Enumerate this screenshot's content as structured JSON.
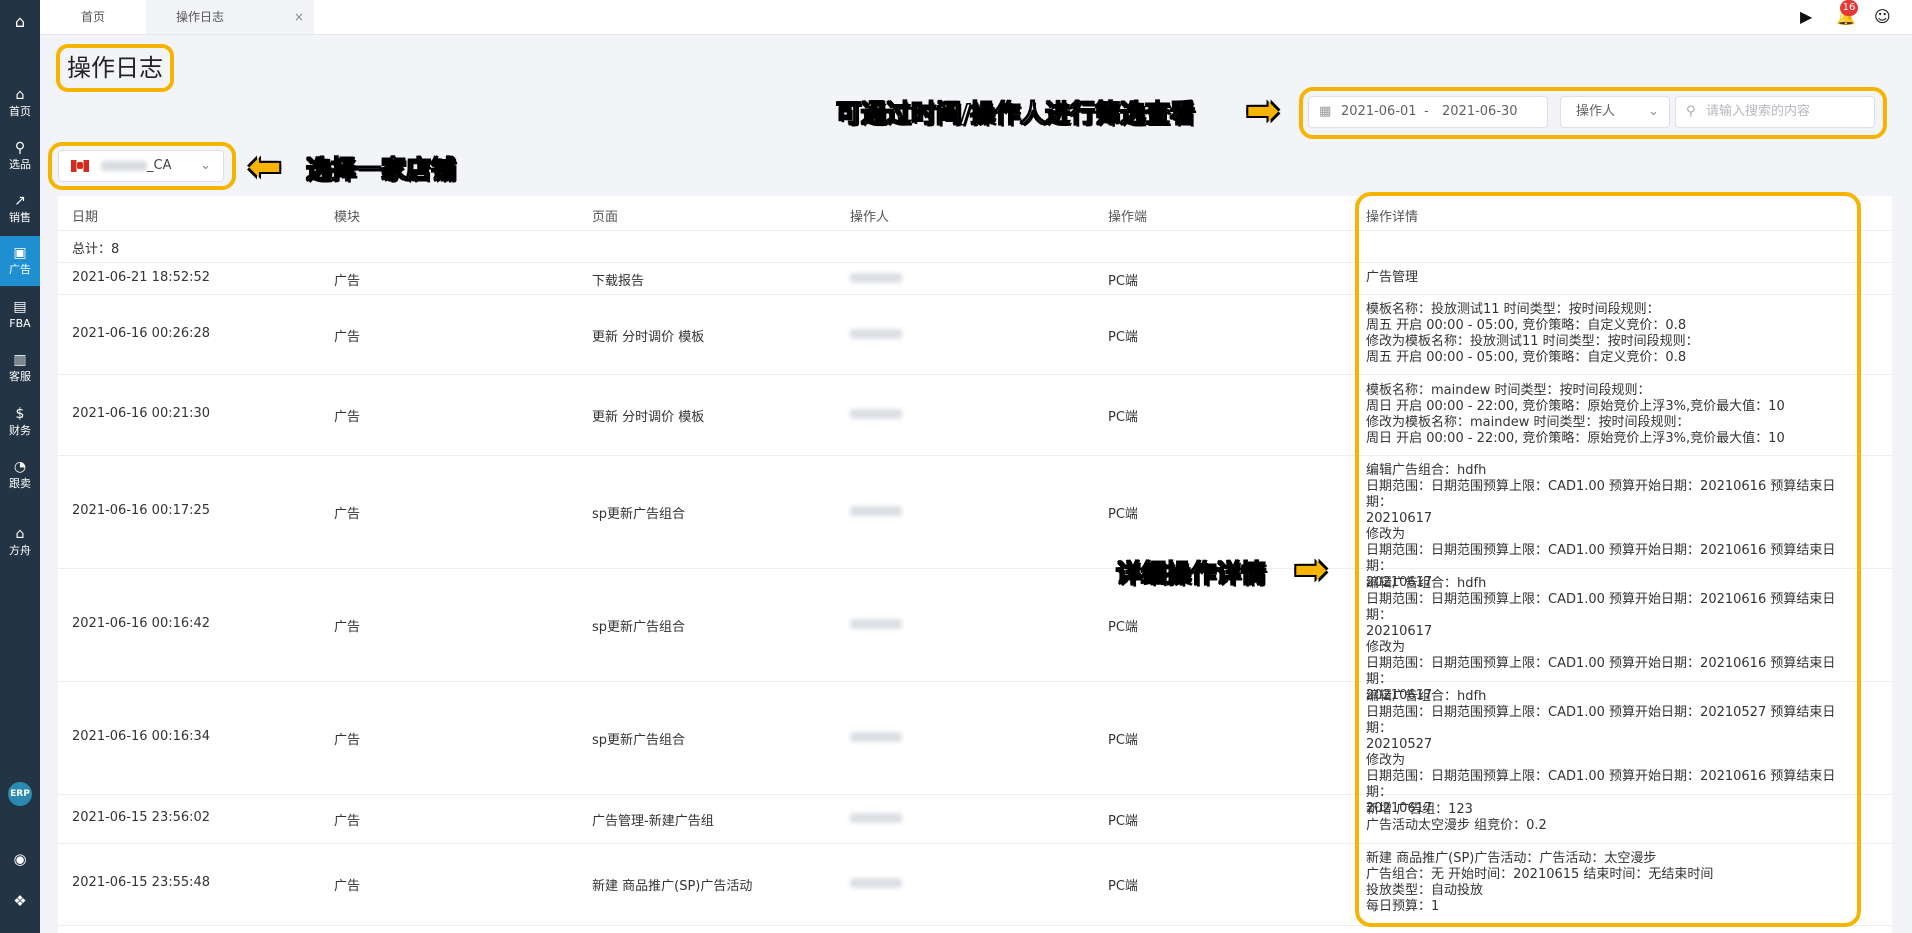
{
  "sidebar": {
    "items": [
      {
        "label": "首页",
        "icon": "home-icon"
      },
      {
        "label": "选品",
        "icon": "search-icon"
      },
      {
        "label": "销售",
        "icon": "chart-icon"
      },
      {
        "label": "广告",
        "icon": "ad-icon"
      },
      {
        "label": "FBA",
        "icon": "fba-icon"
      },
      {
        "label": "客服",
        "icon": "service-icon"
      },
      {
        "label": "财务",
        "icon": "finance-icon"
      },
      {
        "label": "跟卖",
        "icon": "pie-icon"
      },
      {
        "label": "方舟",
        "icon": "ark-icon"
      }
    ],
    "erp_label": "ERP"
  },
  "tabs": {
    "home": "首页",
    "log": "操作日志",
    "close": "×"
  },
  "header": {
    "notification_count": "16"
  },
  "page": {
    "title": "操作日志"
  },
  "filters": {
    "date_start": "2021-06-01",
    "date_sep": "-",
    "date_end": "2021-06-30",
    "operator": "操作人",
    "search_placeholder": "请输入搜索的内容"
  },
  "store": {
    "name_suffix": "_CA"
  },
  "annotations": {
    "filter": "可通过时间/操作人进行筛选查看",
    "store": "选择一家店铺",
    "details": "详细操作详情"
  },
  "table": {
    "headers": [
      "日期",
      "模块",
      "页面",
      "操作人",
      "操作端",
      "操作详情"
    ],
    "total": "总计：8",
    "rows": [
      {
        "date": "2021-06-21 18:52:52",
        "module": "广告",
        "page": "下载报告",
        "client": "PC端",
        "details": [
          "广告管理"
        ]
      },
      {
        "date": "2021-06-16 00:26:28",
        "module": "广告",
        "page": "更新 分时调价 模板",
        "client": "PC端",
        "details": [
          "模板名称：投放测试11 时间类型：按时间段规则：",
          "周五 开启 00:00 - 05:00, 竞价策略：自定义竞价：0.8",
          "修改为模板名称：投放测试11 时间类型：按时间段规则：",
          "周五 开启 00:00 - 05:00, 竞价策略：自定义竞价：0.8"
        ]
      },
      {
        "date": "2021-06-16 00:21:30",
        "module": "广告",
        "page": "更新 分时调价 模板",
        "client": "PC端",
        "details": [
          "模板名称：maindew 时间类型：按时间段规则：",
          "周日 开启 00:00 - 22:00, 竞价策略：原始竞价上浮3%,竞价最大值：10",
          "修改为模板名称：maindew 时间类型：按时间段规则：",
          "周日 开启 00:00 - 22:00, 竞价策略：原始竞价上浮3%,竞价最大值：10"
        ]
      },
      {
        "date": "2021-06-16 00:17:25",
        "module": "广告",
        "page": "sp更新广告组合",
        "client": "PC端",
        "details": [
          "编辑广告组合：hdfh",
          "日期范围：日期范围预算上限：CAD1.00 预算开始日期：20210616 预算结束日期：",
          "20210617",
          "修改为",
          "日期范围：日期范围预算上限：CAD1.00 预算开始日期：20210616 预算结束日期：",
          "20210617"
        ]
      },
      {
        "date": "2021-06-16 00:16:42",
        "module": "广告",
        "page": "sp更新广告组合",
        "client": "PC端",
        "details": [
          "编辑广告组合：hdfh",
          "日期范围：日期范围预算上限：CAD1.00 预算开始日期：20210616 预算结束日期：",
          "20210617",
          "修改为",
          "日期范围：日期范围预算上限：CAD1.00 预算开始日期：20210616 预算结束日期：",
          "20210617"
        ]
      },
      {
        "date": "2021-06-16 00:16:34",
        "module": "广告",
        "page": "sp更新广告组合",
        "client": "PC端",
        "details": [
          "编辑广告组合：hdfh",
          "日期范围：日期范围预算上限：CAD1.00 预算开始日期：20210527 预算结束日期：",
          "20210527",
          "修改为",
          "日期范围：日期范围预算上限：CAD1.00 预算开始日期：20210616 预算结束日期：",
          "20210617"
        ]
      },
      {
        "date": "2021-06-15 23:56:02",
        "module": "广告",
        "page": "广告管理-新建广告组",
        "client": "PC端",
        "details": [
          "新增 广告组：123",
          "广告活动太空漫步 组竞价：0.2"
        ]
      },
      {
        "date": "2021-06-15 23:55:48",
        "module": "广告",
        "page": "新建 商品推广(SP)广告活动",
        "client": "PC端",
        "details": [
          "新建 商品推广(SP)广告活动：广告活动：太空漫步",
          "广告组合：无 开始时间：20210615 结束时间：无结束时间",
          "投放类型：自动投放",
          "每日预算：1"
        ]
      }
    ]
  }
}
